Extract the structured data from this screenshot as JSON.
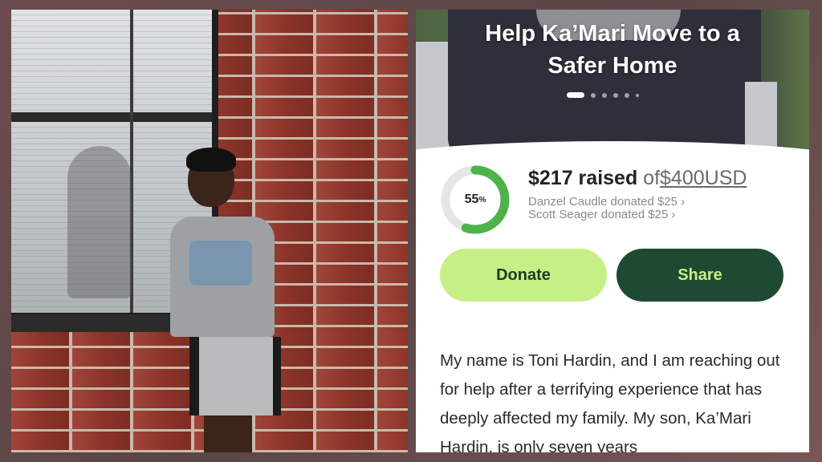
{
  "campaign": {
    "title": "Help Ka’Mari Move to a Safer Home",
    "slide_count": 6,
    "active_slide": 1
  },
  "progress": {
    "percent": 55,
    "percent_label": "55",
    "percent_sign": "%",
    "raised": "$217 raised",
    "of": "of",
    "goal": "$400USD",
    "ring_color": "#4bb34a",
    "ring_track_color": "#e6e6e6"
  },
  "donations": [
    {
      "text": "Danzel Caudle donated $25",
      "chevron": "›"
    },
    {
      "text": "Scott Seager donated $25",
      "chevron": "›"
    }
  ],
  "actions": {
    "donate_label": "Donate",
    "share_label": "Share",
    "donate_color": "#c6f085",
    "share_color": "#1f4a32"
  },
  "story": {
    "text": "My name is Toni Hardin, and I am reaching out for help after a terrifying experience that has deeply affected my family. My son, Ka’Mari Hardin, is only seven years"
  }
}
